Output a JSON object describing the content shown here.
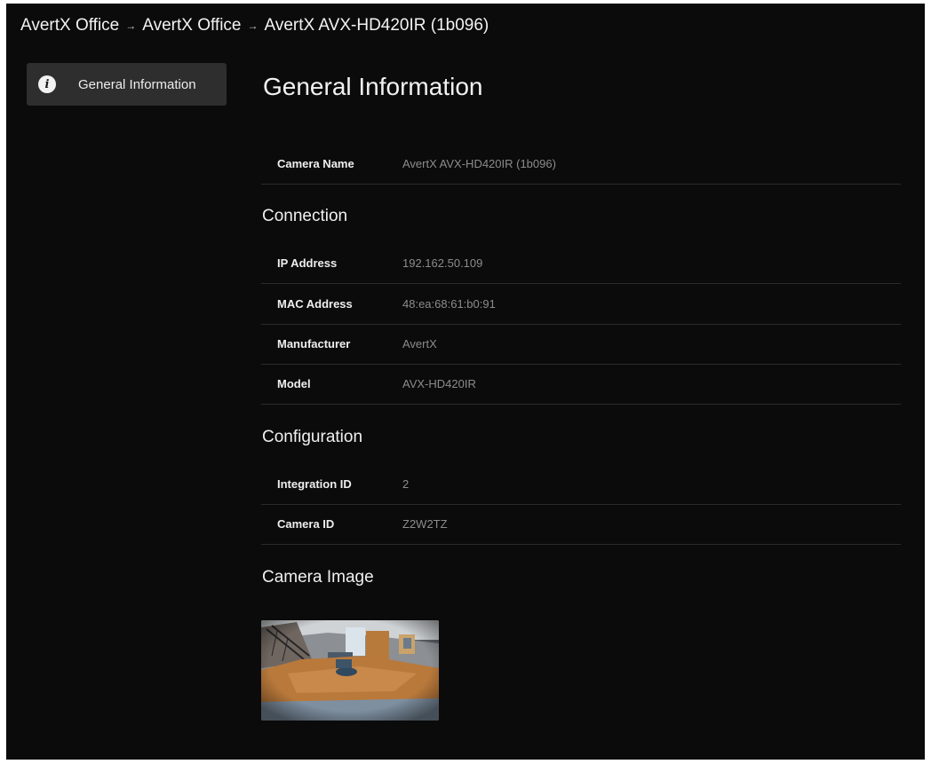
{
  "breadcrumb": {
    "items": [
      "AvertX Office",
      "AvertX Office",
      "AvertX AVX-HD420IR (1b096)"
    ],
    "separator": "→"
  },
  "sidebar": {
    "items": [
      {
        "label": "General Information",
        "icon": "info-icon",
        "active": true
      }
    ]
  },
  "main": {
    "title": "General Information",
    "general_rows": [
      {
        "label": "Camera Name",
        "value": "AvertX AVX-HD420IR (1b096)"
      }
    ],
    "connection": {
      "heading": "Connection",
      "rows": [
        {
          "label": "IP Address",
          "value": "192.162.50.109"
        },
        {
          "label": "MAC Address",
          "value": "48:ea:68:61:b0:91"
        },
        {
          "label": "Manufacturer",
          "value": "AvertX"
        },
        {
          "label": "Model",
          "value": "AVX-HD420IR"
        }
      ]
    },
    "configuration": {
      "heading": "Configuration",
      "rows": [
        {
          "label": "Integration ID",
          "value": "2"
        },
        {
          "label": "Camera ID",
          "value": "Z2W2TZ"
        }
      ]
    },
    "camera_image": {
      "heading": "Camera Image"
    }
  },
  "colors": {
    "background": "#0b0b0b",
    "sidebar_active": "#2e2e2e",
    "text_primary": "#f2f2f2",
    "text_value": "#8c8c8c",
    "divider": "#2a2a2a"
  }
}
